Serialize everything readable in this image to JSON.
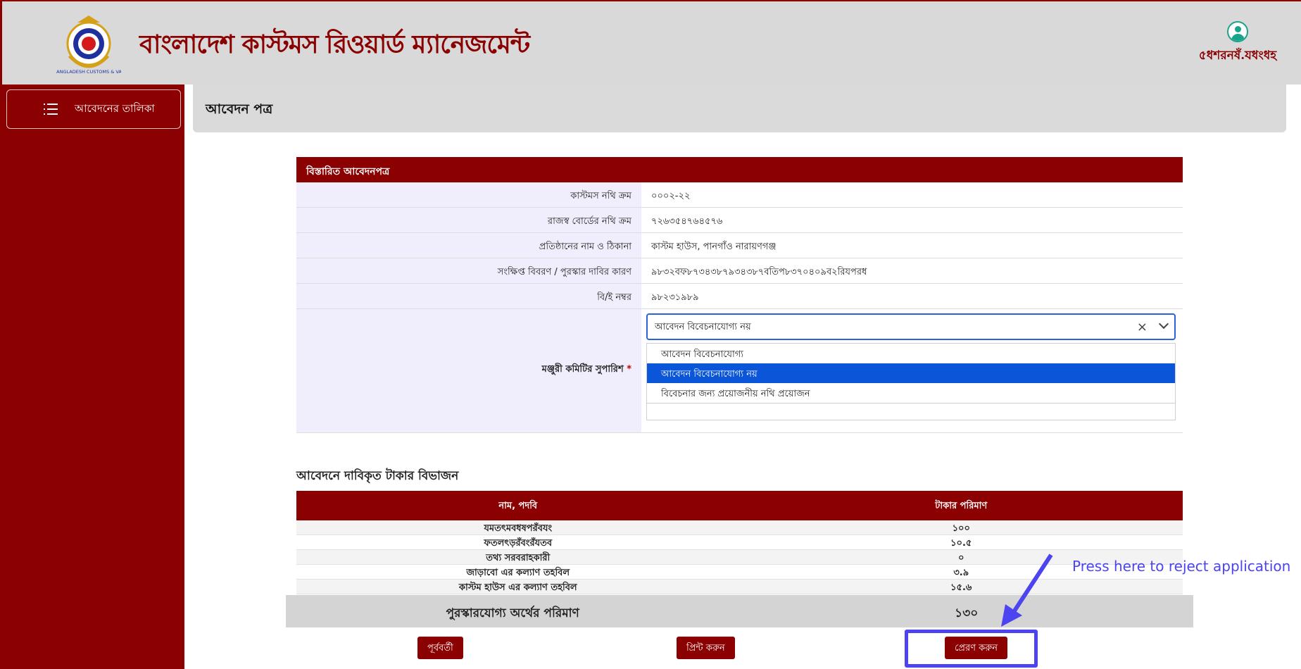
{
  "header": {
    "app_title": "বাংলাদেশ কাস্টমস রিওয়ার্ড ম্যানেজমেন্ট",
    "logo_text": "BANGLADESH CUSTOMS & VAT",
    "user_name": "৫ধশরনষঁ.যধংধহ"
  },
  "sidebar": {
    "items": [
      {
        "label": "আবেদনের তালিকা"
      }
    ]
  },
  "page": {
    "title": "আবেদন পত্র"
  },
  "detail": {
    "section_title": "বিস্তারিত আবেদনপত্র",
    "rows": [
      {
        "label": "কাস্টমস নথি ক্রম",
        "value": "০০০২-২২"
      },
      {
        "label": "রাজস্ব বোর্ডের নথি ক্রম",
        "value": "৭২৬৩৫৪৭৬৪৫৭৬"
      },
      {
        "label": "প্রতিষ্ঠানের নাম ও ঠিকানা",
        "value": "কাস্টম হাউস, পানগাঁও নারায়ণগঞ্জ"
      },
      {
        "label": "সংক্ষিপ্ত বিবরণ / পুরস্কার দাবির কারণ",
        "value": "৯৮৩২বফ৮৭৩৪৩৮৭৯৩৪৩৮৭বতিপ৮৩৭০৪০৯ব২রিযপরধ"
      },
      {
        "label": "বি/ই নম্বর",
        "value": "৯৮২৩১৯৮৯"
      }
    ],
    "recommendation": {
      "label": "মঞ্জুরী কমিটির সুপারিশ",
      "required_mark": "*",
      "selected": "আবেদন বিবেচনাযোগ্য নয়",
      "options": [
        "আবেদন বিবেচনাযোগ্য",
        "আবেদন বিবেচনাযোগ্য নয়",
        "বিবেচনার জন্য প্রয়োজনীয় নথি প্রয়োজন"
      ]
    }
  },
  "breakdown": {
    "title": "আবেদনে দাবিকৃত টাকার বিভাজন",
    "columns": [
      "নাম, পদবি",
      "টাকার পরিমাণ"
    ],
    "rows": [
      {
        "name": "যমতৎমবধষপরঁবযং",
        "amount": "১০০"
      },
      {
        "name": "ফতলৎড়রঁবংরঁযতব",
        "amount": "১০.৫"
      },
      {
        "name": "তথ্য সরবরাহকারী",
        "amount": "০"
      },
      {
        "name": "জাড়াবো এর কল্যাণ তহবিল",
        "amount": "৩.৯"
      },
      {
        "name": "কাস্টম হাউস এর কল্যাণ তহবিল",
        "amount": "১৫.৬"
      }
    ],
    "total_label": "পুরস্কারযোগ্য অর্থের পরিমাণ",
    "total_value": "১৩০"
  },
  "actions": {
    "prev": "পূর্ববর্তী",
    "print": "প্রিন্ট করুন",
    "send": "প্রেরণ করুন"
  },
  "annotation": {
    "text": "Press here to reject application"
  },
  "colors": {
    "brand": "#8b0000",
    "highlight": "#4b44f0",
    "selected_option": "#0a55d8"
  }
}
